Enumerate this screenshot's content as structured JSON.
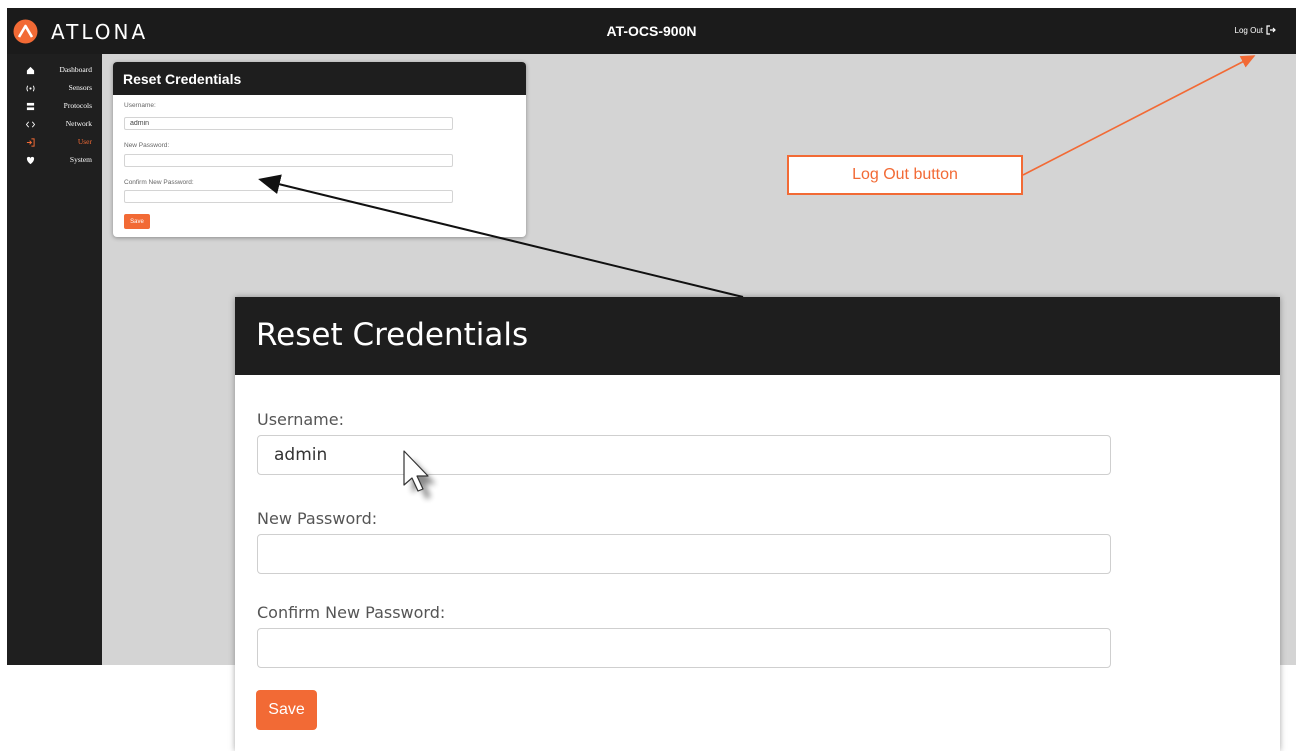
{
  "topbar": {
    "brand": "ATLONA",
    "device_name": "AT-OCS-900N",
    "logout_label": "Log Out"
  },
  "sidebar": {
    "items": [
      {
        "label": "Dashboard",
        "icon": "home-icon",
        "active": false
      },
      {
        "label": "Sensors",
        "icon": "sensor-icon",
        "active": false
      },
      {
        "label": "Protocols",
        "icon": "protocols-icon",
        "active": false
      },
      {
        "label": "Network",
        "icon": "network-icon",
        "active": false
      },
      {
        "label": "User",
        "icon": "login-icon",
        "active": true
      },
      {
        "label": "System",
        "icon": "system-icon",
        "active": false
      }
    ]
  },
  "card": {
    "title": "Reset Credentials",
    "username_label": "Username:",
    "username_value": "admin",
    "new_password_label": "New Password:",
    "new_password_value": "",
    "confirm_password_label": "Confirm New Password:",
    "confirm_password_value": "",
    "save_label": "Save"
  },
  "callout": {
    "text": "Log Out button"
  },
  "colors": {
    "accent": "#f26a35",
    "topbar": "#1b1b1b",
    "sidebar": "#1f1f1f",
    "content_bg": "#d4d4d4"
  }
}
